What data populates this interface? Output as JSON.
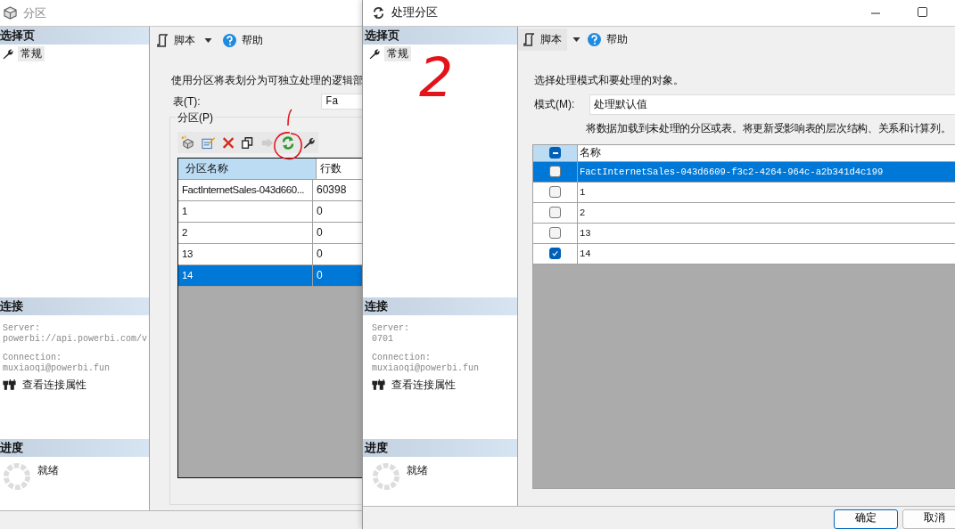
{
  "left_window": {
    "title": "分区",
    "sidebar": {
      "header": "选择页",
      "items": [
        {
          "label": "常规",
          "selected": true
        }
      ]
    },
    "toolbar": {
      "script": "脚本",
      "help": "帮助"
    },
    "description": "使用分区将表划分为可独立处理的逻辑部",
    "table_label": "表(T):",
    "table_value": "Fa",
    "group_label": "分区(P)",
    "grid": {
      "columns": [
        "分区名称",
        "行数"
      ],
      "rows": [
        {
          "name": "FactInternetSales-043d660...",
          "count": "60398",
          "selected": false
        },
        {
          "name": "1",
          "count": "0",
          "selected": false
        },
        {
          "name": "2",
          "count": "0",
          "selected": false
        },
        {
          "name": "13",
          "count": "0",
          "selected": false
        },
        {
          "name": "14",
          "count": "0",
          "selected": true
        }
      ]
    },
    "connection": {
      "header": "连接",
      "server_label": "Server:",
      "server": "powerbi://api.powerbi.com/v",
      "connection_label": "Connection:",
      "connection": "muxiaoqi@powerbi.fun",
      "link": "查看连接属性"
    },
    "progress": {
      "header": "进度",
      "status": "就绪"
    }
  },
  "right_window": {
    "title": "处理分区",
    "sidebar": {
      "header": "选择页",
      "items": [
        {
          "label": "常规",
          "selected": true
        }
      ]
    },
    "toolbar": {
      "script": "脚本",
      "help": "帮助"
    },
    "description": "选择处理模式和要处理的对象。",
    "mode_label": "模式(M):",
    "mode_value": "处理默认值",
    "mode_hint": "将数据加载到未处理的分区或表。将更新受影响表的层次结构、关系和计算列。",
    "grid": {
      "column": "名称",
      "select_all": {
        "indeterminate": true
      },
      "rows": [
        {
          "name": "FactInternetSales-043d6609-f3c2-4264-964c-a2b341d4c199",
          "checked": false,
          "selected": true
        },
        {
          "name": "1",
          "checked": false,
          "selected": false
        },
        {
          "name": "2",
          "checked": false,
          "selected": false
        },
        {
          "name": "13",
          "checked": false,
          "selected": false
        },
        {
          "name": "14",
          "checked": true,
          "selected": false
        }
      ]
    },
    "connection": {
      "header": "连接",
      "server_label": "Server:",
      "server": "0701",
      "connection_label": "Connection:",
      "connection": "muxiaoqi@powerbi.fun",
      "link": "查看连接属性"
    },
    "progress": {
      "header": "进度",
      "status": "就绪"
    },
    "buttons": [
      "确定",
      "取消"
    ]
  },
  "annotations": [
    {
      "kind": "text",
      "text": "2"
    },
    {
      "kind": "circle"
    },
    {
      "kind": "stroke"
    }
  ]
}
